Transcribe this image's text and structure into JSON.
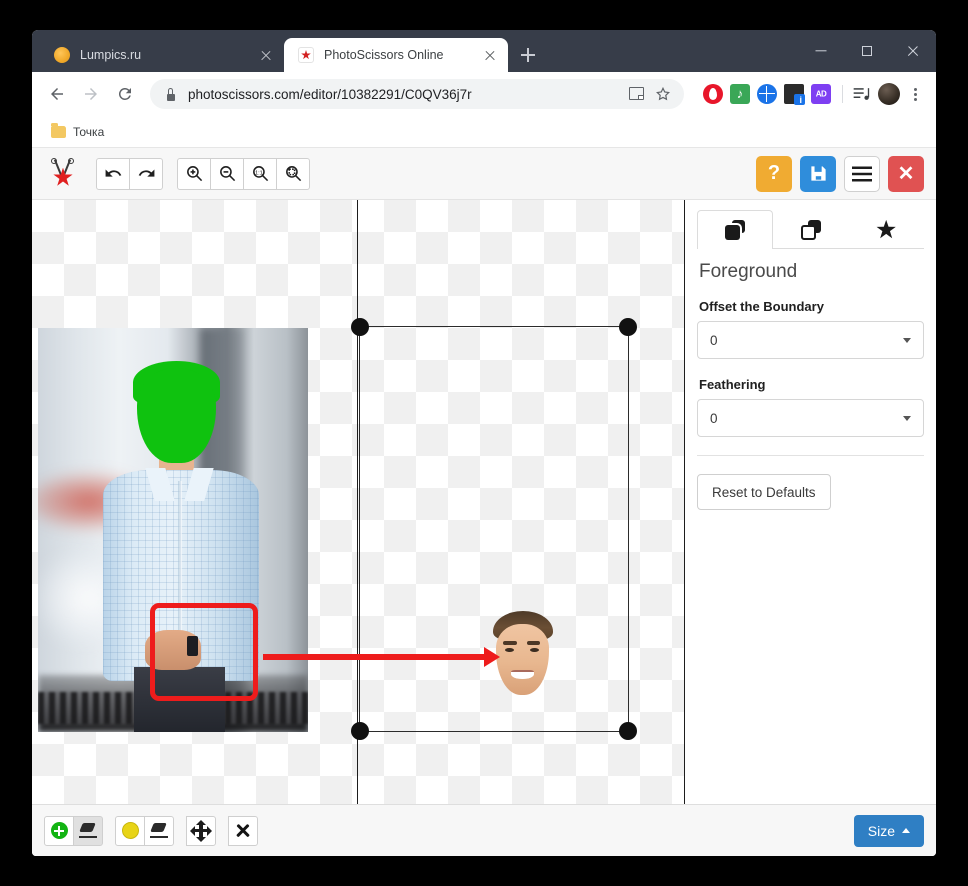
{
  "browser": {
    "tabs": [
      {
        "title": "Lumpics.ru",
        "favicon": "lumpics-favicon",
        "active": false
      },
      {
        "title": "PhotoScissors Online",
        "favicon": "photoscissors-favicon",
        "active": true
      }
    ],
    "new_tab_label": "+",
    "window_controls": {
      "minimize": "minimize",
      "maximize": "maximize",
      "close": "close"
    },
    "nav": {
      "back": "back-arrow",
      "forward": "forward-arrow",
      "reload": "reload-arrow"
    },
    "omnibox": {
      "lock": "lock-icon",
      "url_domain": "photoscissors.com",
      "url_path": "/editor/10382291/C0QV36j7r",
      "url_full": "photoscissors.com/editor/10382291/C0QV36j7r",
      "translate": "translate-icon",
      "bookmark_star": "star-icon"
    },
    "extensions": [
      {
        "name": "opera-extension-icon",
        "color": "#e8162a"
      },
      {
        "name": "music-extension-icon",
        "color": "#3aa757"
      },
      {
        "name": "globe-extension-icon",
        "color": "#1a73e8"
      },
      {
        "name": "box-extension-icon",
        "color": "#2b2b2b",
        "badge": "i"
      },
      {
        "name": "adblock-extension-icon",
        "color": "#7e3ff2",
        "label": "AD"
      }
    ],
    "playlist_icon": "playlist-icon",
    "profile_avatar": "avatar",
    "menu_icon": "kebab-menu-icon",
    "bookmarks": [
      {
        "label": "Точка",
        "icon": "folder-icon"
      }
    ]
  },
  "app": {
    "logo": "photoscissors-logo",
    "toolbar": {
      "undo": "undo-icon",
      "redo": "redo-icon",
      "zoom_in": "zoom-in-icon",
      "zoom_out": "zoom-out-icon",
      "zoom_actual": "zoom-actual-size-icon",
      "zoom_fit": "zoom-fit-icon",
      "help": "?",
      "save": "save-icon",
      "menu": "hamburger-icon",
      "close": "✕"
    },
    "panel": {
      "tabs": [
        {
          "name": "foreground-tab",
          "icon": "layers-filled-icon",
          "active": true
        },
        {
          "name": "background-tab",
          "icon": "layers-outline-icon",
          "active": false
        },
        {
          "name": "effects-tab",
          "icon": "star-icon",
          "active": false
        }
      ],
      "title": "Foreground",
      "fields": [
        {
          "label": "Offset the Boundary",
          "value": "0"
        },
        {
          "label": "Feathering",
          "value": "0"
        }
      ],
      "reset_label": "Reset to Defaults"
    },
    "bottom_toolbar": {
      "tools": [
        {
          "name": "foreground-marker-tool",
          "icon": "green-plus-icon",
          "selected": false
        },
        {
          "name": "foreground-eraser-tool",
          "icon": "eraser-icon",
          "selected": true
        },
        {
          "name": "background-marker-tool",
          "icon": "yellow-dot-icon",
          "selected": false
        },
        {
          "name": "background-eraser-tool",
          "icon": "eraser-icon",
          "selected": false
        },
        {
          "name": "move-tool",
          "icon": "move-icon",
          "selected": false
        },
        {
          "name": "delete-tool",
          "icon": "x-icon",
          "selected": false
        }
      ],
      "size_label": "Size"
    },
    "canvas": {
      "source_photo_alt": "man-in-blue-shirt-photo",
      "marked_region": "green-foreground-mask-on-face",
      "result_alt": "cut-out-face-result",
      "annotation": {
        "box": "red-highlight-box",
        "arrow": "red-arrow"
      },
      "crop_handles": [
        "top-left",
        "top-right",
        "bottom-left",
        "bottom-right"
      ]
    }
  }
}
